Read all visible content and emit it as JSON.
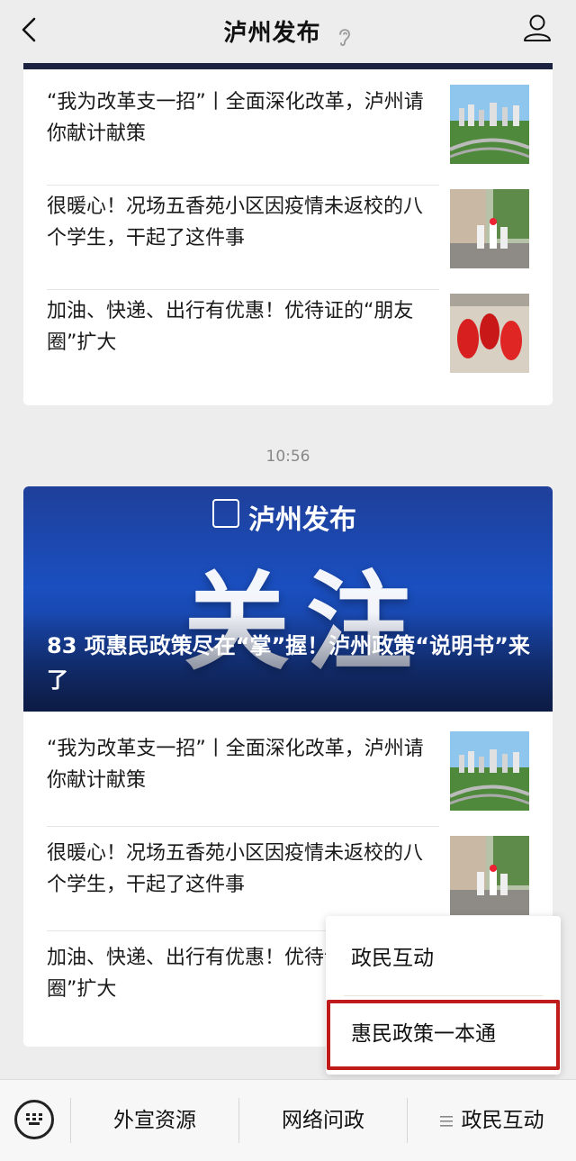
{
  "header": {
    "title": "泸州发布"
  },
  "card1": {
    "items": [
      {
        "title": "“我为改革支一招”丨全面深化改革，泸州请你献计献策"
      },
      {
        "title": "很暖心！况场五香苑小区因疫情未返校的八个学生，干起了这件事"
      },
      {
        "title": "加油、快递、出行有优惠！优待证的“朋友圈”扩大"
      }
    ]
  },
  "timestamp": "10:56",
  "card2": {
    "banner": {
      "brand": "泸州发布",
      "big_text": "关注",
      "headline": "83 项惠民政策尽在“掌”握！泸州政策“说明书”来了"
    },
    "items": [
      {
        "title": "“我为改革支一招”丨全面深化改革，泸州请你献计献策"
      },
      {
        "title": "很暖心！况场五香苑小区因疫情未返校的八个学生，干起了这件事"
      },
      {
        "title": "加油、快递、出行有优惠！优待证的“朋友圈”扩大"
      }
    ]
  },
  "popup_menu": {
    "items": [
      "政民互动",
      "惠民政策一本通"
    ],
    "highlight_color": "#c01b1b"
  },
  "bottom_menu": {
    "items": [
      "外宣资源",
      "网络问政",
      "政民互动"
    ]
  }
}
